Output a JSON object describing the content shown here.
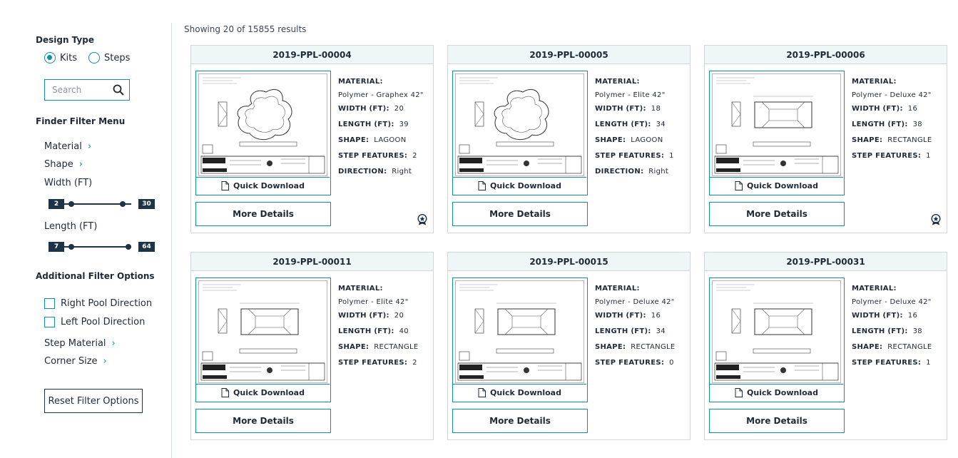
{
  "sidebar": {
    "design_type_heading": "Design Type",
    "design_options": [
      {
        "label": "Kits",
        "selected": true
      },
      {
        "label": "Steps",
        "selected": false
      }
    ],
    "search_placeholder": "Search",
    "finder_heading": "Finder Filter Menu",
    "menu": [
      "Material",
      "Shape"
    ],
    "width": {
      "label": "Width (FT)",
      "min": "2",
      "max": "30"
    },
    "length": {
      "label": "Length (FT)",
      "min": "7",
      "max": "64"
    },
    "additional_heading": "Additional Filter Options",
    "checkboxes": [
      "Right Pool Direction",
      "Left Pool Direction"
    ],
    "menu2": [
      "Step Material",
      "Corner Size"
    ],
    "reset_label": "Reset Filter Options"
  },
  "main": {
    "results_text": "Showing 20 of 15855 results",
    "quick_download_label": "Quick Download",
    "more_details_label": "More Details",
    "labels": {
      "material": "MATERIAL:",
      "width": "WIDTH (FT):",
      "length": "LENGTH (FT):",
      "shape": "SHAPE:",
      "steps": "STEP FEATURES:",
      "direction": "DIRECTION:"
    },
    "cards": [
      {
        "id": "2019-PPL-00004",
        "material": "Polymer - Graphex 42\"",
        "width": "20",
        "length": "39",
        "shape": "LAGOON",
        "steps": "2",
        "direction": "Right",
        "kind": "lagoon",
        "badge": true
      },
      {
        "id": "2019-PPL-00005",
        "material": "Polymer - Elite 42\"",
        "width": "18",
        "length": "34",
        "shape": "LAGOON",
        "steps": "1",
        "direction": "Right",
        "kind": "lagoon",
        "badge": false
      },
      {
        "id": "2019-PPL-00006",
        "material": "Polymer - Deluxe 42\"",
        "width": "16",
        "length": "38",
        "shape": "RECTANGLE",
        "steps": "1",
        "kind": "rect",
        "badge": true
      },
      {
        "id": "2019-PPL-00011",
        "material": "Polymer - Elite 42\"",
        "width": "20",
        "length": "40",
        "shape": "RECTANGLE",
        "steps": "2",
        "kind": "rect",
        "badge": false
      },
      {
        "id": "2019-PPL-00015",
        "material": "Polymer - Deluxe 42\"",
        "width": "16",
        "length": "34",
        "shape": "RECTANGLE",
        "steps": "0",
        "kind": "rect",
        "badge": false
      },
      {
        "id": "2019-PPL-00031",
        "material": "Polymer - Deluxe 42\"",
        "width": "16",
        "length": "38",
        "shape": "RECTANGLE",
        "steps": "1",
        "kind": "rect",
        "badge": false
      }
    ]
  }
}
